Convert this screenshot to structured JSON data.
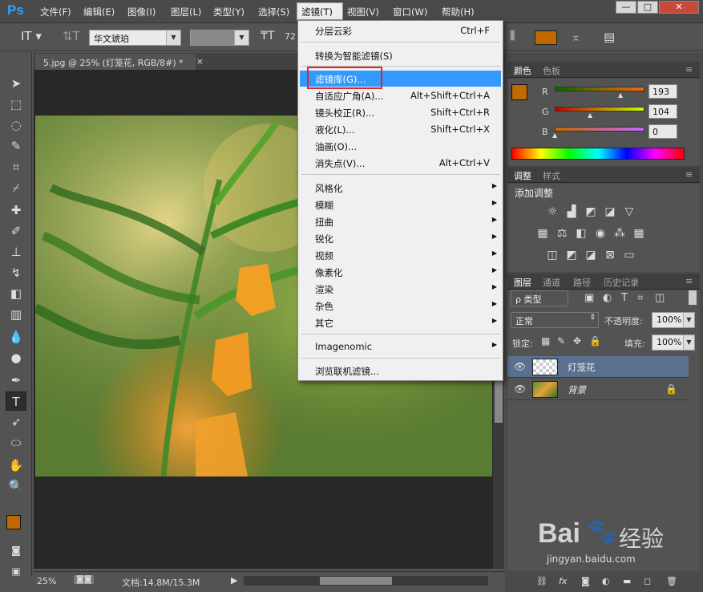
{
  "app_logo": "Ps",
  "menu": [
    "文件(F)",
    "编辑(E)",
    "图像(I)",
    "图层(L)",
    "类型(Y)",
    "选择(S)",
    "滤镜(T)",
    "视图(V)",
    "窗口(W)",
    "帮助(H)"
  ],
  "options": {
    "font_family": "华文琥珀",
    "font_style": "-",
    "font_size": "72"
  },
  "document": {
    "tab_title": "5.jpg @ 25% (灯笼花, RGB/8#) *",
    "close": "×",
    "zoom": "25%",
    "doc_info": "文档:14.8M/15.3M"
  },
  "filter_menu": {
    "last_filter": {
      "label": "分层云彩",
      "shortcut": "Ctrl+F"
    },
    "smart": "转换为智能滤镜(S)",
    "items": [
      {
        "label": "滤镜库(G)...",
        "shortcut": ""
      },
      {
        "label": "自适应广角(A)...",
        "shortcut": "Alt+Shift+Ctrl+A"
      },
      {
        "label": "镜头校正(R)...",
        "shortcut": "Shift+Ctrl+R"
      },
      {
        "label": "液化(L)...",
        "shortcut": "Shift+Ctrl+X"
      },
      {
        "label": "油画(O)...",
        "shortcut": ""
      },
      {
        "label": "消失点(V)...",
        "shortcut": "Alt+Ctrl+V"
      }
    ],
    "submenus": [
      "风格化",
      "模糊",
      "扭曲",
      "锐化",
      "视频",
      "像素化",
      "渲染",
      "杂色",
      "其它"
    ],
    "plugin": "Imagenomic",
    "browse": "浏览联机滤镜..."
  },
  "color_panel": {
    "tabs": [
      "颜色",
      "色板"
    ],
    "r": {
      "label": "R",
      "value": "193"
    },
    "g": {
      "label": "G",
      "value": "104"
    },
    "b": {
      "label": "B",
      "value": "0"
    },
    "fg_color": "#c16800"
  },
  "adjust_panel": {
    "tabs": [
      "调整",
      "样式"
    ],
    "title": "添加调整"
  },
  "layers_panel": {
    "tabs": [
      "图层",
      "通道",
      "路径",
      "历史记录"
    ],
    "filter_kind": "ρ 类型",
    "blend_mode": "正常",
    "opacity_label": "不透明度:",
    "opacity": "100%",
    "lock_label": "锁定:",
    "fill_label": "填充:",
    "fill": "100%",
    "layers": [
      {
        "name": "灯笼花"
      },
      {
        "name": "背景"
      }
    ]
  },
  "watermark": {
    "brand": "Bai",
    "brand2": "经验",
    "url": "jingyan.baidu.com"
  }
}
